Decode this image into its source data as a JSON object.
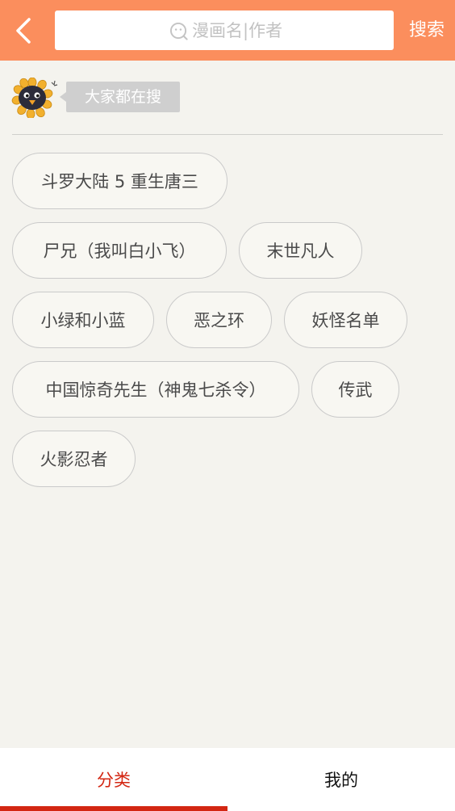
{
  "header": {
    "back_icon": "back-arrow-icon",
    "search_placeholder": "漫画名|作者",
    "search_icon": "search-face-icon",
    "search_button": "搜索"
  },
  "hot": {
    "mascot_icon": "sunflower-penguin-mascot",
    "label": "大家都在搜",
    "tags": [
      "斗罗大陆 5 重生唐三",
      "尸兄（我叫白小飞）",
      "末世凡人",
      "小绿和小蓝",
      "恶之环",
      "妖怪名单",
      "中国惊奇先生（神鬼七杀令）",
      "传武",
      "火影忍者"
    ]
  },
  "bottom_nav": {
    "tabs": [
      {
        "label": "分类",
        "active": true
      },
      {
        "label": "我的",
        "active": false
      }
    ]
  },
  "colors": {
    "header_bg": "#fb8e5d",
    "page_bg": "#f4f3ee",
    "active_tab": "#d32612"
  }
}
